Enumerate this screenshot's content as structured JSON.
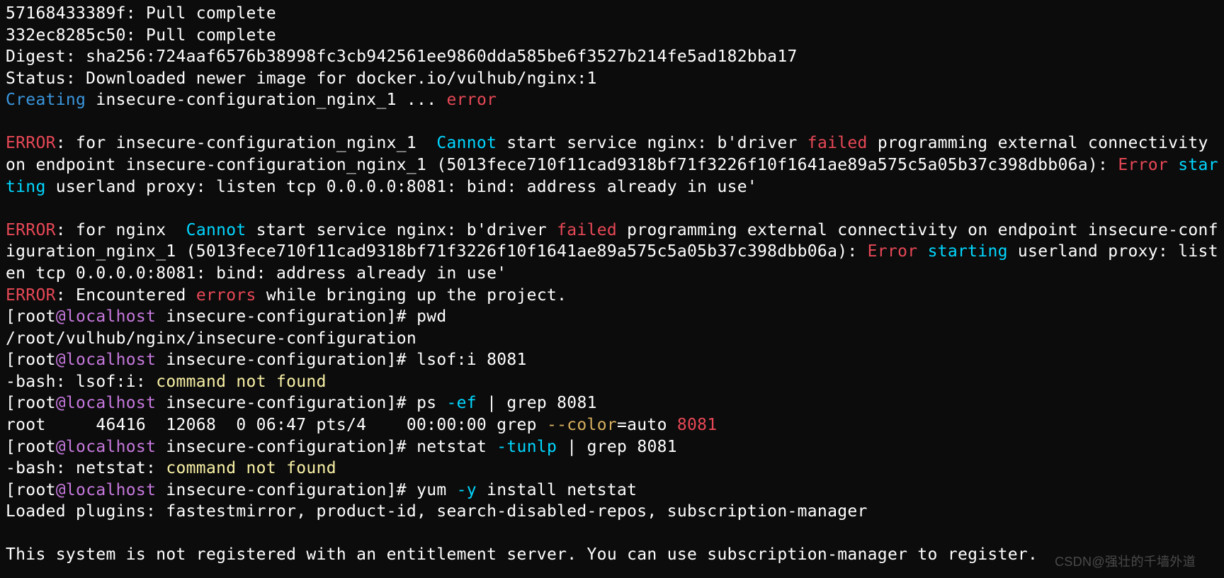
{
  "l1": "57168433389f: Pull complete",
  "l2": "332ec8285c50: Pull complete",
  "l3": "Digest: sha256:724aaf6576b38998fc3cb942561ee9860dda585be6f3527b214fe5ad182bba17",
  "l4": "Status: Downloaded newer image for docker.io/vulhub/nginx:1",
  "creating1": "Creating",
  "creating2": " insecure-configuration_nginx_1 ... ",
  "creating3": "error",
  "e1a": "ERROR",
  "e1b": ": for insecure-configuration_nginx_1  ",
  "e1c": "Cannot",
  "e1d": " start service nginx: b'driver ",
  "e1e": "failed",
  "e1f": " programming external connectivity on endpoint insecure-configuration_nginx_1 (5013fece710f11cad9318bf71f3226f10f1641ae89a575c5a05b37c398dbb06a): ",
  "e1g": "Error",
  "e1h": " ",
  "e1i": "starting",
  "e1j": " userland proxy: listen tcp 0.0.0.0:8081: bind: address already in use'",
  "e2a": "ERROR",
  "e2b": ": for nginx  ",
  "e2c": "Cannot",
  "e2d": " start service nginx: b'driver ",
  "e2e": "failed",
  "e2f": " programming external connectivity on endpoint insecure-configuration_nginx_1 (5013fece710f11cad9318bf71f3226f10f1641ae89a575c5a05b37c398dbb06a): ",
  "e2g": "Error",
  "e2h": " ",
  "e2i": "starting",
  "e2j": " userland proxy: listen tcp 0.0.0.0:8081: bind: address already in use'",
  "e3a": "ERROR",
  "e3b": ": Encountered ",
  "e3c": "errors",
  "e3d": " while bringing up the project.",
  "p1a": "[root",
  "p1b": "@localhost",
  "p1c": " insecure-configuration]# ",
  "cmd1": "pwd",
  "out1": "/root/vulhub/nginx/insecure-configuration",
  "cmd2": "lsof:i 8081",
  "bash2a": "-bash: lsof:i: ",
  "bash2b": "command not found",
  "cmd3a": "ps ",
  "cmd3b": "-ef",
  "cmd3c": " | grep 8081",
  "out3a": "root     46416  12068  0 06:47 pts/4    00:00:00 grep ",
  "out3b": "--color",
  "out3c": "=auto ",
  "out3d": "8081",
  "cmd4a": "netstat ",
  "cmd4b": "-tunlp",
  "cmd4c": " | grep 8081",
  "bash4a": "-bash: netstat: ",
  "bash4b": "command not found",
  "cmd5a": "yum ",
  "cmd5b": "-y",
  "cmd5c": " install netstat",
  "out5": "Loaded plugins: fastestmirror, product-id, search-disabled-repos, subscription-manager",
  "last": "This system is not registered with an entitlement server. You can use subscription-manager to register.",
  "watermark": "CSDN@强壮的千墙外道"
}
